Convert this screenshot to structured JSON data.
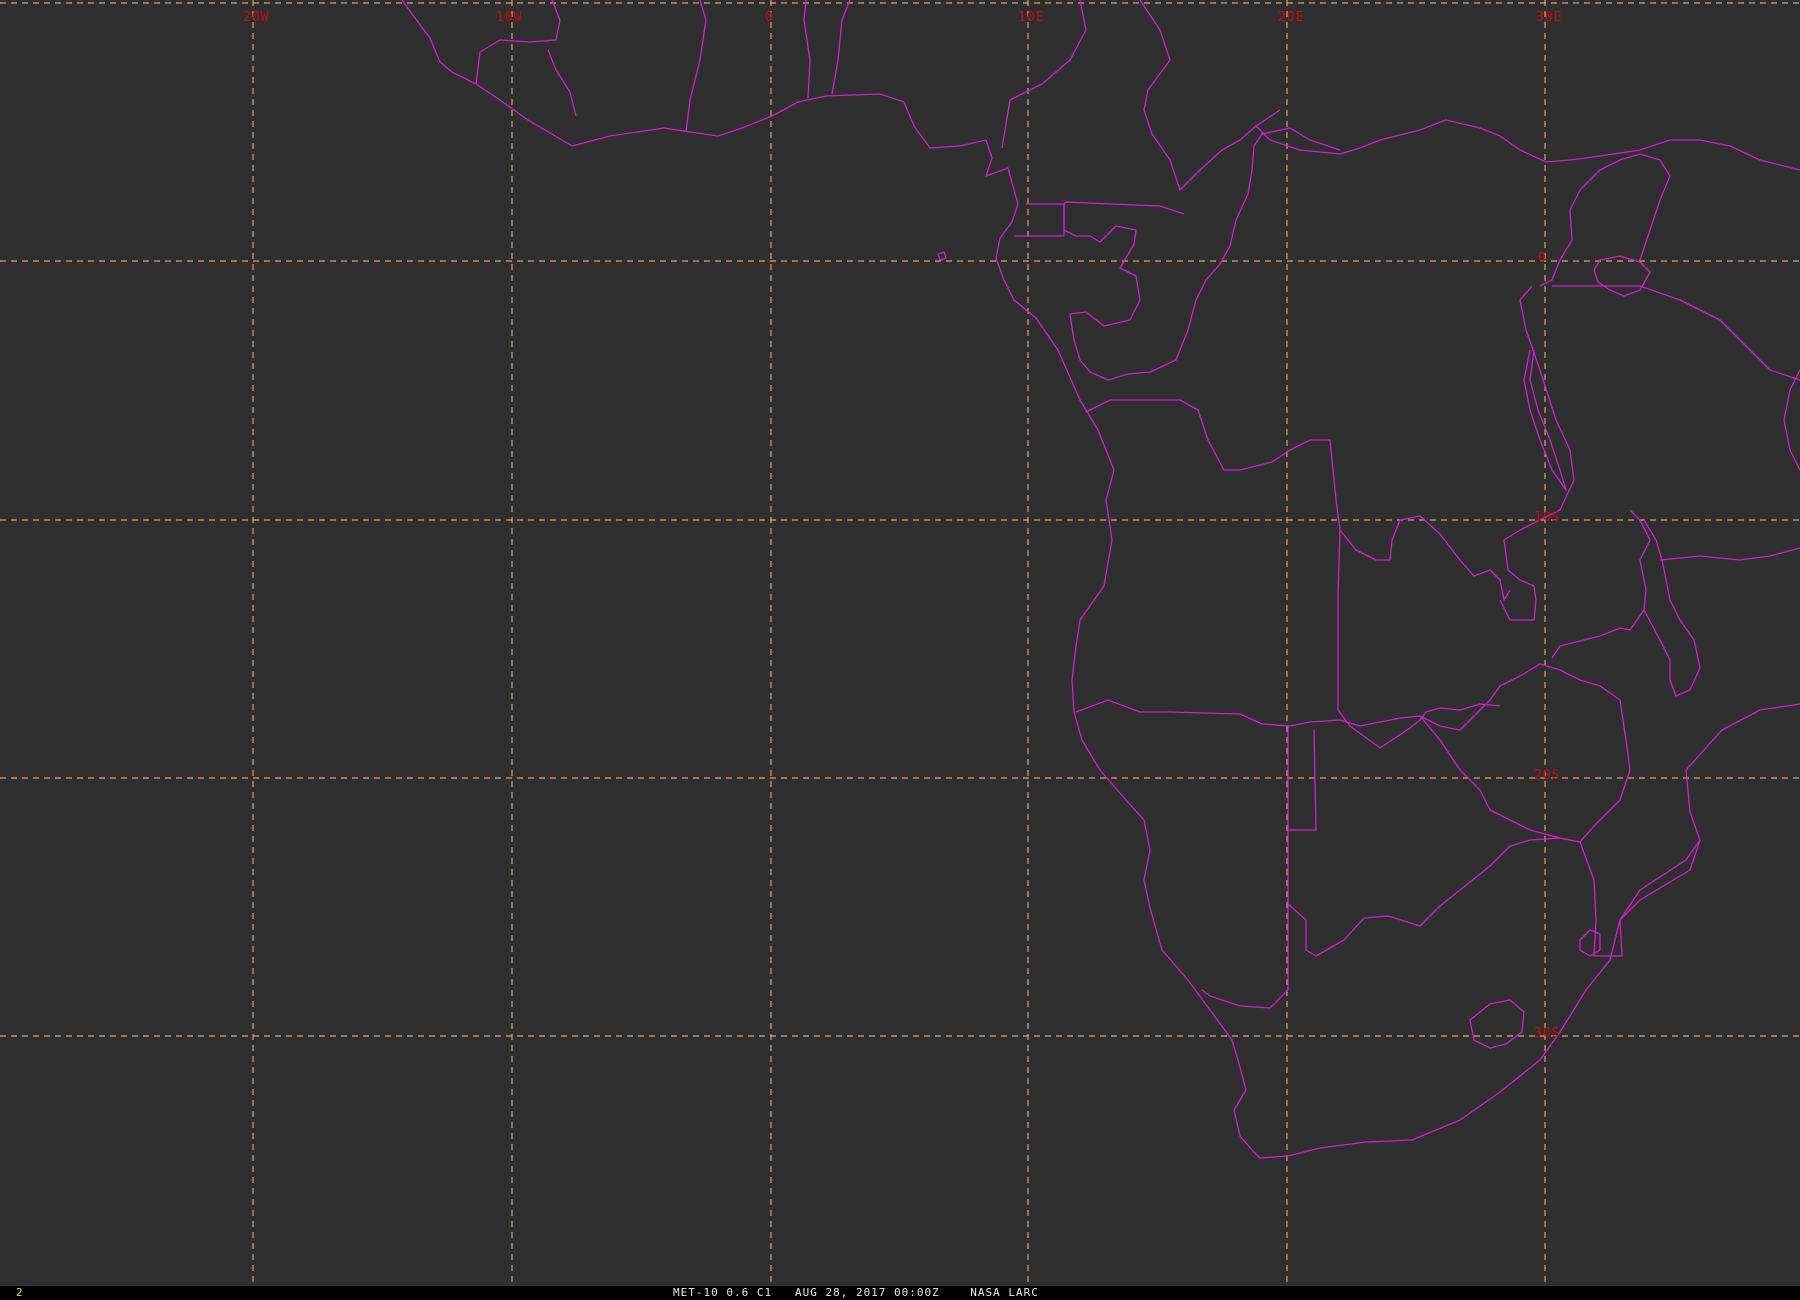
{
  "map": {
    "longitude_labels": [
      "20W",
      "10W",
      "0",
      "10E",
      "20E",
      "30E"
    ],
    "latitude_labels": [
      "0",
      "10S",
      "20S",
      "30S"
    ],
    "grid_color": "#e0a070",
    "label_color": "#c01010",
    "boundary_color": "#d020d0",
    "background": "#2f2f2f"
  },
  "status_bar": {
    "frame_number": "2",
    "caption": "MET-10 0.6 C1   AUG 28, 2017 00:00Z    NASA LARC"
  }
}
